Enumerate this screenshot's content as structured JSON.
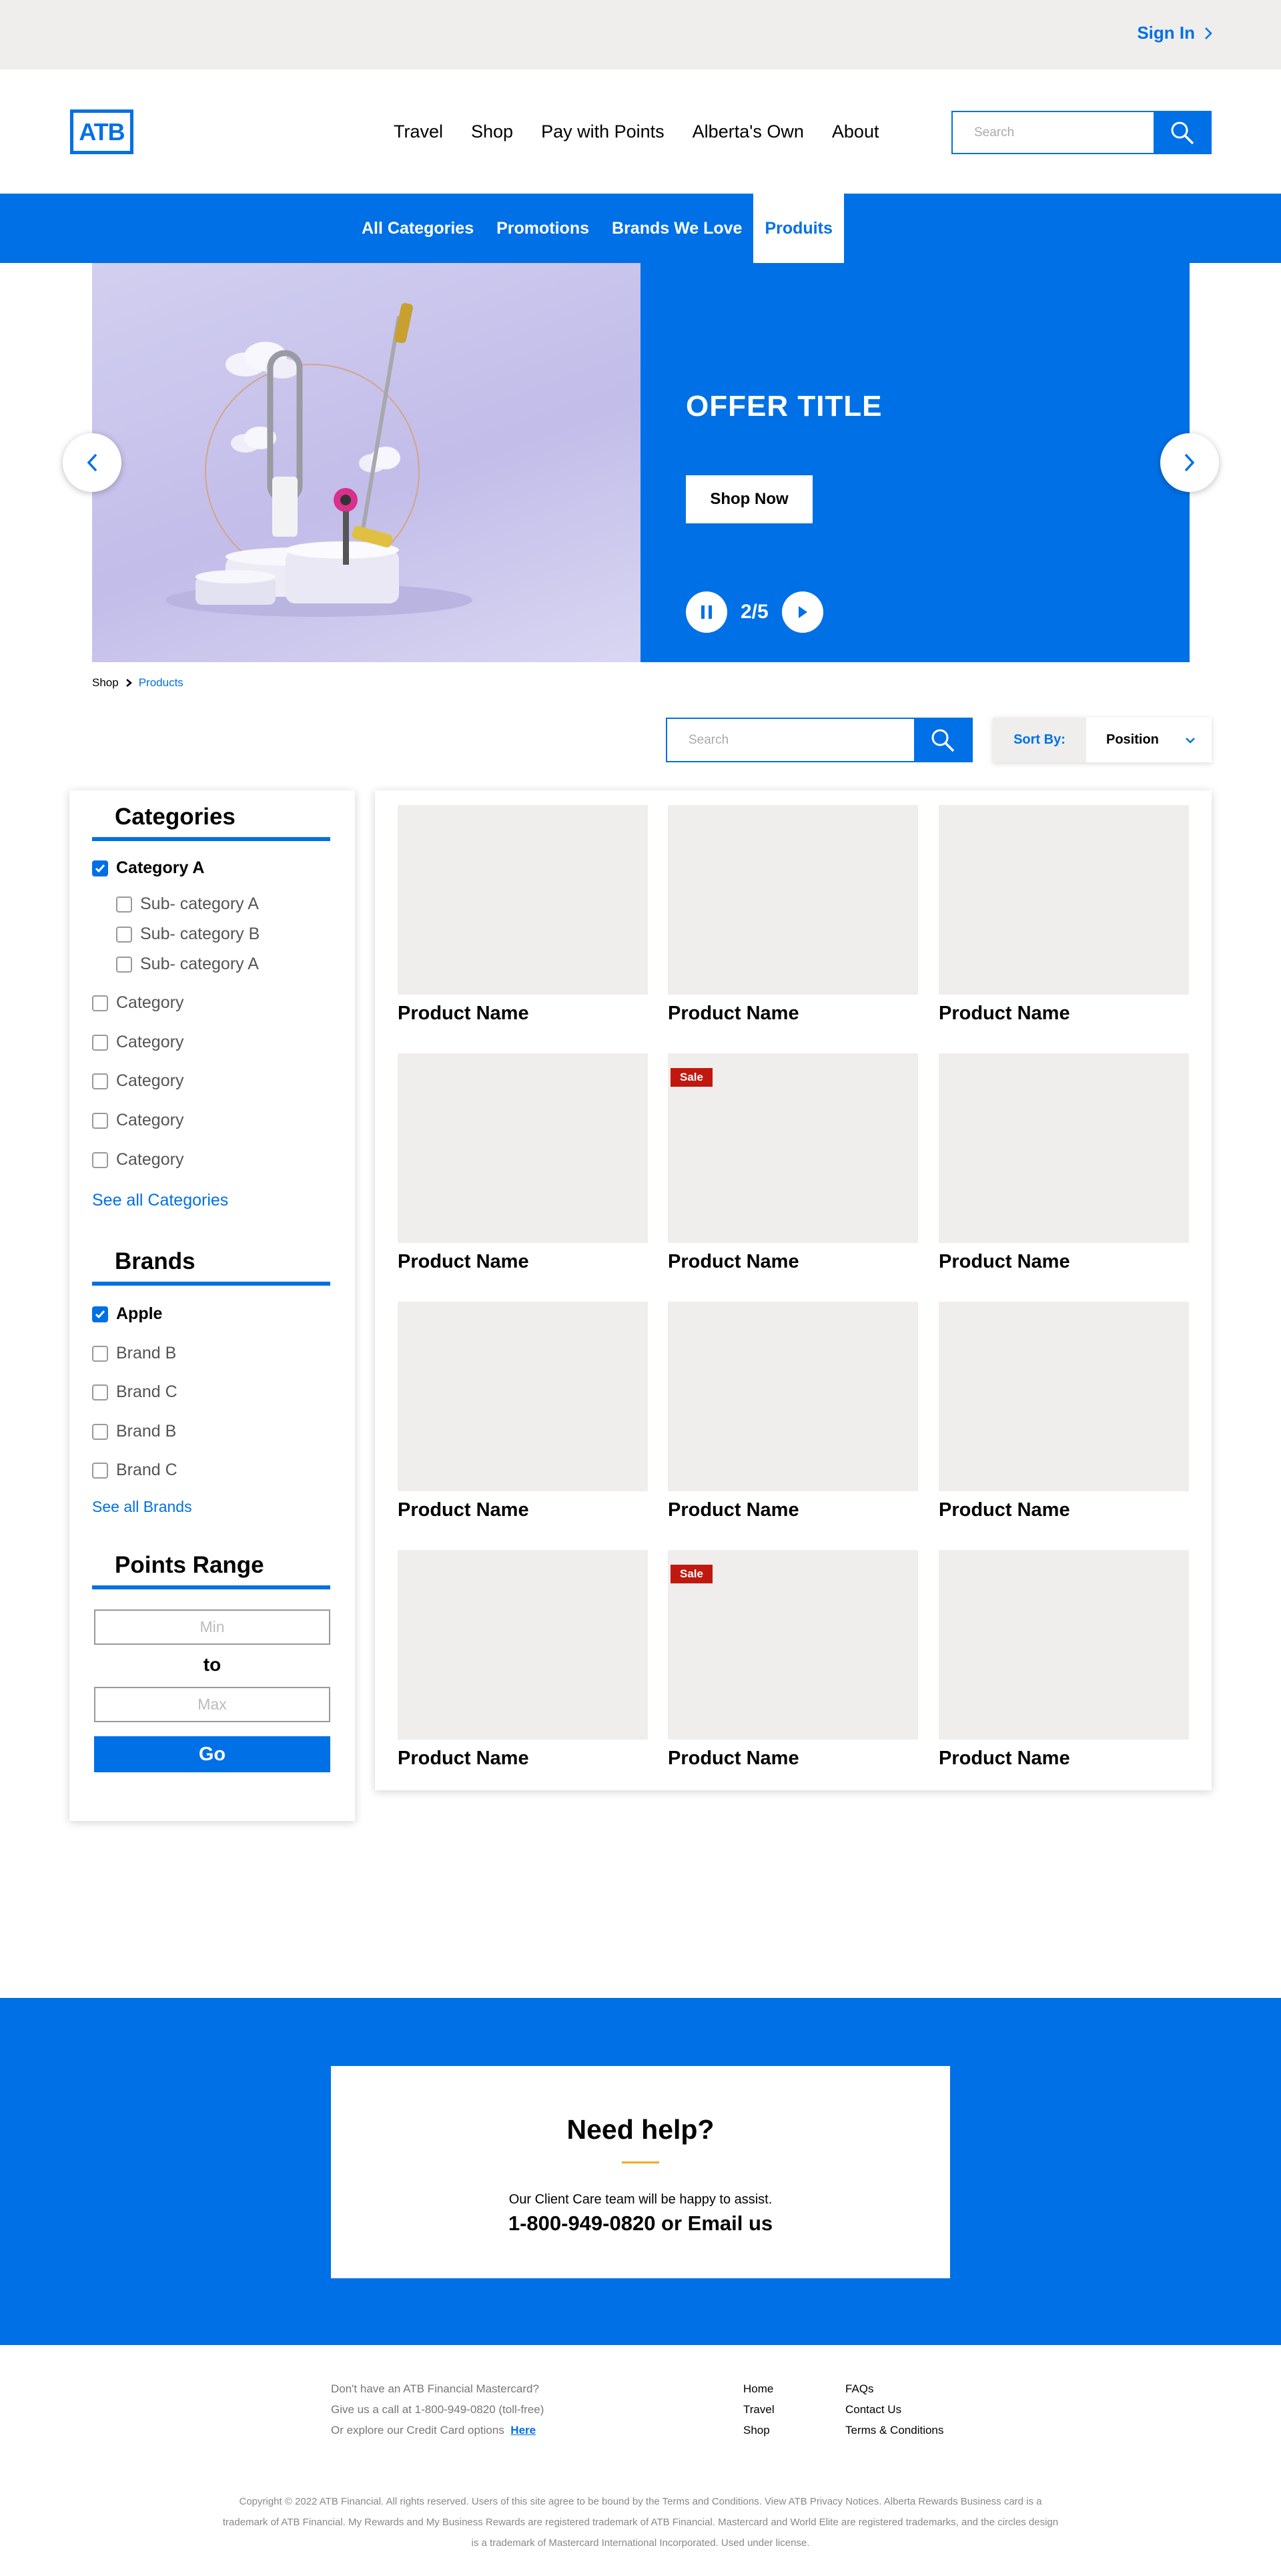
{
  "topbar": {
    "sign_in": "Sign In"
  },
  "header": {
    "logo": "ATB",
    "nav": [
      "Travel",
      "Shop",
      "Pay with Points",
      "Alberta's Own",
      "About"
    ],
    "search_placeholder": "Search"
  },
  "category_nav": [
    "All Categories",
    "Promotions",
    "Brands We Love",
    "Produits"
  ],
  "hero": {
    "offer_title": "OFFER TITLE",
    "cta": "Shop Now",
    "counter": "2/5"
  },
  "breadcrumb": {
    "root": "Shop",
    "current": "Products"
  },
  "toolbar": {
    "search_placeholder": "Search",
    "sort_label": "Sort By:",
    "sort_value": "Position"
  },
  "sidebar": {
    "categories_title": "Categories",
    "categories": [
      {
        "label": "Category A",
        "checked": true
      },
      {
        "label": "Sub- category A",
        "checked": false
      },
      {
        "label": "Sub- category B",
        "checked": false
      },
      {
        "label": "Sub- category A",
        "checked": false
      },
      {
        "label": "Category",
        "checked": false
      },
      {
        "label": "Category",
        "checked": false
      },
      {
        "label": "Category",
        "checked": false
      },
      {
        "label": "Category",
        "checked": false
      },
      {
        "label": "Category",
        "checked": false
      }
    ],
    "see_all_categories": "See all Categories",
    "brands_title": "Brands",
    "brands": [
      {
        "label": "Apple",
        "checked": true
      },
      {
        "label": "Brand B",
        "checked": false
      },
      {
        "label": "Brand C",
        "checked": false
      },
      {
        "label": "Brand B",
        "checked": false
      },
      {
        "label": "Brand C",
        "checked": false
      }
    ],
    "see_all_brands": "See all Brands",
    "points_title": "Points Range",
    "min_placeholder": "Min",
    "to": "to",
    "max_placeholder": "Max",
    "go": "Go"
  },
  "products": [
    {
      "name": "Product Name",
      "badge": ""
    },
    {
      "name": "Product Name",
      "badge": ""
    },
    {
      "name": "Product Name",
      "badge": ""
    },
    {
      "name": "Product Name",
      "badge": ""
    },
    {
      "name": "Product Name",
      "badge": "Sale"
    },
    {
      "name": "Product Name",
      "badge": ""
    },
    {
      "name": "Product Name",
      "badge": ""
    },
    {
      "name": "Product Name",
      "badge": ""
    },
    {
      "name": "Product Name",
      "badge": ""
    },
    {
      "name": "Product Name",
      "badge": ""
    },
    {
      "name": "Product Name",
      "badge": "Sale"
    },
    {
      "name": "Product Name",
      "badge": ""
    }
  ],
  "help": {
    "title": "Need help?",
    "subtitle": "Our Client Care team will be happy to assist.",
    "contact": "1-800-949-0820 or Email us"
  },
  "footer": {
    "left_line1": "Don't have an ATB Financial Mastercard?",
    "left_line2": "Give us a call at 1-800-949-0820 (toll-free)",
    "left_line3": "Or explore our Credit Card options",
    "left_link": "Here",
    "col1": [
      "Home",
      "Travel",
      "Shop"
    ],
    "col2": [
      "FAQs",
      "Contact Us",
      "Terms & Conditions"
    ],
    "copyright": "Copyright © 2022 ATB Financial. All rights reserved. Users of this site agree to be bound by the Terms and Conditions. View ATB Privacy Notices. Alberta Rewards Business card is a trademark of ATB Financial. My Rewards and My Business Rewards are registered trademark of ATB Financial. Mastercard and World Elite are registered trademarks, and the circles design is a trademark of Mastercard International Incorporated. Used under license."
  },
  "colors": {
    "brand": "#0070e6",
    "sale": "#c0180f",
    "placeholder_bg": "#efeeec"
  },
  "icons": [
    "chevron-right-icon",
    "search-icon",
    "pause-icon",
    "play-icon",
    "chevron-left-icon",
    "chevron-down-icon",
    "check-icon"
  ]
}
